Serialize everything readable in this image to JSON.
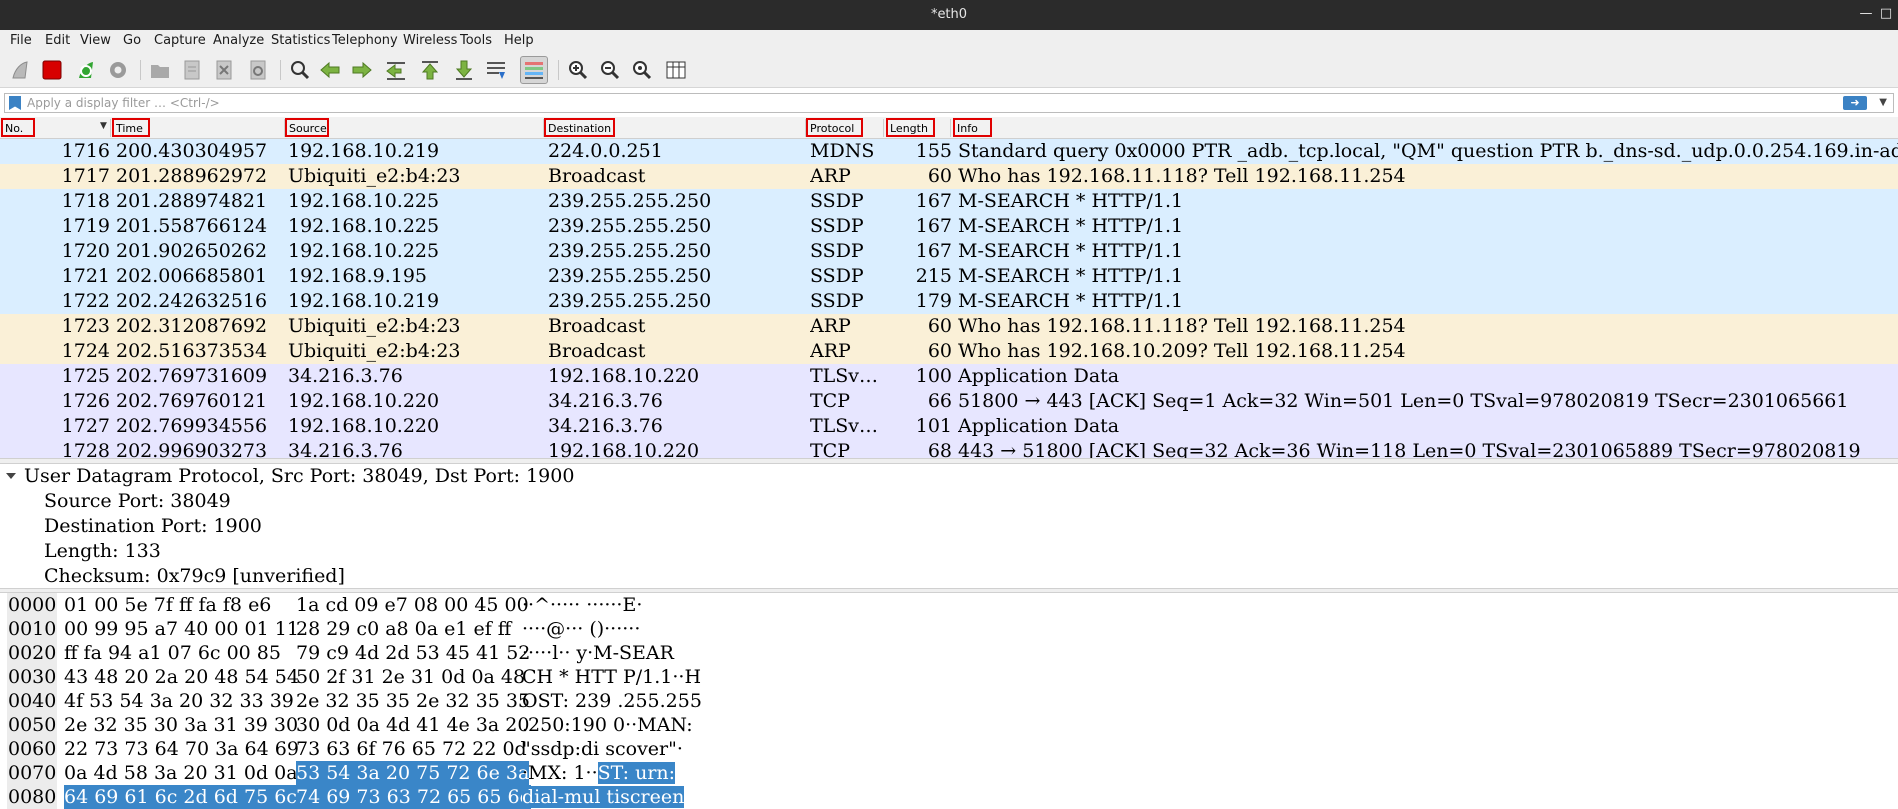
{
  "window": {
    "title": "*eth0"
  },
  "menu": [
    "File",
    "Edit",
    "View",
    "Go",
    "Capture",
    "Analyze",
    "Statistics",
    "Telephony",
    "Wireless",
    "Tools",
    "Help"
  ],
  "toolbar": {
    "icons": [
      "shark-fin-start-icon",
      "stop-capture-icon",
      "restart-capture-icon",
      "capture-options-icon",
      "open-file-icon",
      "save-file-icon",
      "close-file-icon",
      "reload-file-icon",
      "find-packet-icon",
      "go-back-icon",
      "go-forward-icon",
      "go-to-packet-icon",
      "go-first-icon",
      "go-last-icon",
      "autoscroll-icon",
      "colorize-icon",
      "zoom-in-icon",
      "zoom-out-icon",
      "zoom-normal-icon",
      "resize-columns-icon"
    ]
  },
  "filter": {
    "placeholder": "Apply a display filter … <Ctrl-/>"
  },
  "columns": {
    "no": "No.",
    "time": "Time",
    "source": "Source",
    "destination": "Destination",
    "protocol": "Protocol",
    "length": "Length",
    "info": "Info"
  },
  "colors": {
    "mdns_ssdp": "#daeeff",
    "arp": "#faf0d7",
    "tls_tcp": "#e7e6ff",
    "highlight": "#3a86c8",
    "column_outline": "#e00000"
  },
  "packets": [
    {
      "no": "1716",
      "time": "200.430304957",
      "source": "192.168.10.219",
      "destination": "224.0.0.251",
      "protocol": "MDNS",
      "length": "155",
      "info": "Standard query 0x0000 PTR _adb._tcp.local, \"QM\" question PTR b._dns-sd._udp.0.0.254.169.in-ad…",
      "bg": "#daeeff"
    },
    {
      "no": "1717",
      "time": "201.288962972",
      "source": "Ubiquiti_e2:b4:23",
      "destination": "Broadcast",
      "protocol": "ARP",
      "length": "60",
      "info": "Who has 192.168.11.118? Tell 192.168.11.254",
      "bg": "#faf0d7"
    },
    {
      "no": "1718",
      "time": "201.288974821",
      "source": "192.168.10.225",
      "destination": "239.255.255.250",
      "protocol": "SSDP",
      "length": "167",
      "info": "M-SEARCH * HTTP/1.1",
      "bg": "#daeeff"
    },
    {
      "no": "1719",
      "time": "201.558766124",
      "source": "192.168.10.225",
      "destination": "239.255.255.250",
      "protocol": "SSDP",
      "length": "167",
      "info": "M-SEARCH * HTTP/1.1",
      "bg": "#daeeff"
    },
    {
      "no": "1720",
      "time": "201.902650262",
      "source": "192.168.10.225",
      "destination": "239.255.255.250",
      "protocol": "SSDP",
      "length": "167",
      "info": "M-SEARCH * HTTP/1.1",
      "bg": "#daeeff"
    },
    {
      "no": "1721",
      "time": "202.006685801",
      "source": "192.168.9.195",
      "destination": "239.255.255.250",
      "protocol": "SSDP",
      "length": "215",
      "info": "M-SEARCH * HTTP/1.1",
      "bg": "#daeeff"
    },
    {
      "no": "1722",
      "time": "202.242632516",
      "source": "192.168.10.219",
      "destination": "239.255.255.250",
      "protocol": "SSDP",
      "length": "179",
      "info": "M-SEARCH * HTTP/1.1",
      "bg": "#daeeff"
    },
    {
      "no": "1723",
      "time": "202.312087692",
      "source": "Ubiquiti_e2:b4:23",
      "destination": "Broadcast",
      "protocol": "ARP",
      "length": "60",
      "info": "Who has 192.168.11.118? Tell 192.168.11.254",
      "bg": "#faf0d7"
    },
    {
      "no": "1724",
      "time": "202.516373534",
      "source": "Ubiquiti_e2:b4:23",
      "destination": "Broadcast",
      "protocol": "ARP",
      "length": "60",
      "info": "Who has 192.168.10.209? Tell 192.168.11.254",
      "bg": "#faf0d7"
    },
    {
      "no": "1725",
      "time": "202.769731609",
      "source": "34.216.3.76",
      "destination": "192.168.10.220",
      "protocol": "TLSv…",
      "length": "100",
      "info": "Application Data",
      "bg": "#e7e6ff"
    },
    {
      "no": "1726",
      "time": "202.769760121",
      "source": "192.168.10.220",
      "destination": "34.216.3.76",
      "protocol": "TCP",
      "length": "66",
      "info": "51800 → 443 [ACK] Seq=1 Ack=32 Win=501 Len=0 TSval=978020819 TSecr=2301065661",
      "bg": "#e7e6ff"
    },
    {
      "no": "1727",
      "time": "202.769934556",
      "source": "192.168.10.220",
      "destination": "34.216.3.76",
      "protocol": "TLSv…",
      "length": "101",
      "info": "Application Data",
      "bg": "#e7e6ff"
    },
    {
      "no": "1728",
      "time": "202.996903273",
      "source": "34.216.3.76",
      "destination": "192.168.10.220",
      "protocol": "TCP",
      "length": "68",
      "info": "443 → 51800 [ACK] Seq=32 Ack=36 Win=118 Len=0 TSval=2301065889 TSecr=978020819",
      "bg": "#e7e6ff"
    }
  ],
  "details": {
    "header": "User Datagram Protocol, Src Port: 38049, Dst Port: 1900",
    "fields": [
      "Source Port: 38049",
      "Destination Port: 1900",
      "Length: 133",
      "Checksum: 0x79c9 [unverified]"
    ]
  },
  "hex": [
    {
      "off": "0000",
      "b1": "01 00 5e 7f ff fa f8 e6",
      "b2": "1a cd 09 e7 08 00 45 00",
      "asc": "··^····· ······E·",
      "b2hl": "",
      "aschl": ""
    },
    {
      "off": "0010",
      "b1": "00 99 95 a7 40 00 01 11",
      "b2": "28 29 c0 a8 0a e1 ef ff",
      "asc": "····@··· ()······",
      "b2hl": "",
      "aschl": ""
    },
    {
      "off": "0020",
      "b1": "ff fa 94 a1 07 6c 00 85",
      "b2": "79 c9 4d 2d 53 45 41 52",
      "asc": "·····l·· y·M-SEAR",
      "b2hl": "",
      "aschl": ""
    },
    {
      "off": "0030",
      "b1": "43 48 20 2a 20 48 54 54",
      "b2": "50 2f 31 2e 31 0d 0a 48",
      "asc": "CH * HTT P/1.1··H",
      "b2hl": "",
      "aschl": ""
    },
    {
      "off": "0040",
      "b1": "4f 53 54 3a 20 32 33 39",
      "b2": "2e 32 35 35 2e 32 35 35",
      "asc": "OST: 239 .255.255",
      "b2hl": "",
      "aschl": ""
    },
    {
      "off": "0050",
      "b1": "2e 32 35 30 3a 31 39 30",
      "b2": "30 0d 0a 4d 41 4e 3a 20",
      "asc": ".250:190 0··MAN: ",
      "b2hl": "",
      "aschl": ""
    },
    {
      "off": "0060",
      "b1": "22 73 73 64 70 3a 64 69",
      "b2": "73 63 6f 76 65 72 22 0d",
      "asc": "\"ssdp:di scover\"·",
      "b2hl": "",
      "aschl": ""
    },
    {
      "off": "0070",
      "b1": "0a 4d 58 3a 20 31 0d 0a",
      "b2": "",
      "asc": "·MX: 1··",
      "b2hl": "53 54 3a 20 75 72 6e 3a",
      "aschl": "ST: urn:"
    },
    {
      "off": "0080",
      "b1": "",
      "b2": "",
      "asc": "",
      "b1hl": "64 69 61 6c 2d 6d 75 6c",
      "b2hl": "74 69 73 63 72 65 65 6e",
      "aschl": "dial-mul tiscreen"
    }
  ]
}
